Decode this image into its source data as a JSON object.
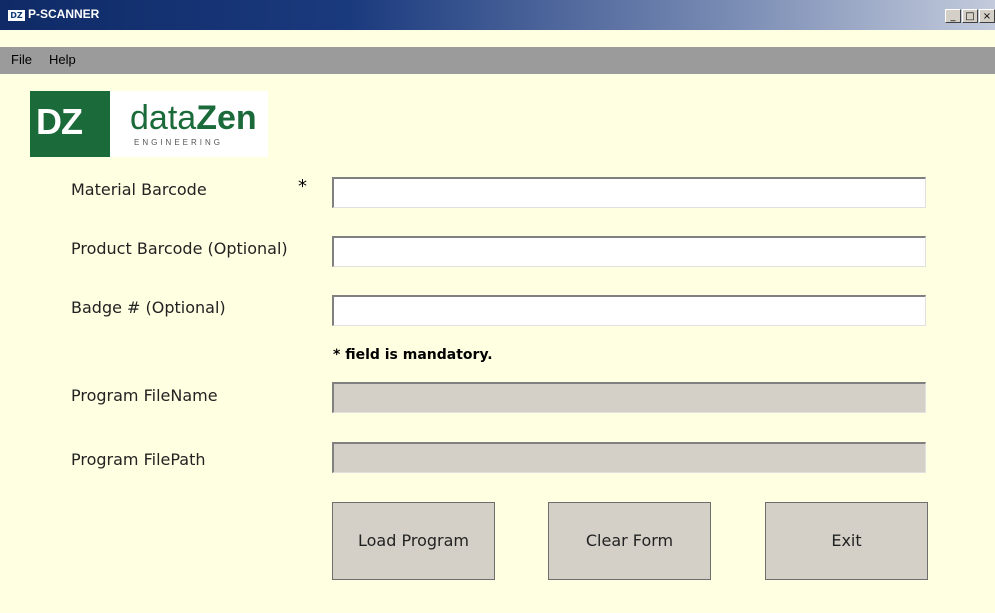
{
  "window": {
    "icon_text": "DZ",
    "title": "P-SCANNER",
    "controls": {
      "minimize": "_",
      "maximize": "□",
      "close": "×"
    }
  },
  "menu": {
    "items": [
      "File",
      "Help"
    ]
  },
  "logo": {
    "mark": "DZ",
    "word_light": "data",
    "word_bold": "Zen",
    "subtitle": "ENGINEERING"
  },
  "form": {
    "material_barcode": {
      "label": "Material Barcode",
      "required_marker": "*",
      "value": ""
    },
    "product_barcode": {
      "label": "Product Barcode (Optional)",
      "value": ""
    },
    "badge": {
      "label": "Badge # (Optional)",
      "value": ""
    },
    "mandatory_note": "* field is mandatory.",
    "program_filename": {
      "label": "Program FileName",
      "value": ""
    },
    "program_filepath": {
      "label": "Program FilePath",
      "value": ""
    }
  },
  "buttons": {
    "load": "Load Program",
    "clear": "Clear Form",
    "exit": "Exit"
  },
  "colors": {
    "background": "#ffffe2",
    "menubar": "#9b9b9b",
    "titlebar_start": "#0f2a66",
    "logo_green": "#1a6a3a",
    "readonly_field": "#d4d0c8"
  }
}
